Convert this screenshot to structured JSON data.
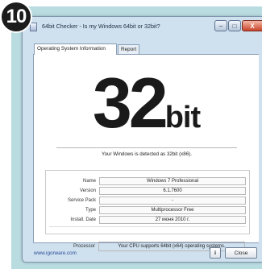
{
  "step_badge": "10",
  "window": {
    "title": "64bit Checker - Is my Windows 64bit or 32bit?",
    "icon": "app-window-icon",
    "controls": {
      "minimize": "–",
      "maximize": "□",
      "close": "X"
    }
  },
  "tabs": [
    {
      "label": "Operating System Information",
      "active": true
    },
    {
      "label": "Report",
      "active": false
    }
  ],
  "result": {
    "number": "32",
    "unit": "bit",
    "detected_text": "Your Windows is detected as 32bit (x86)."
  },
  "info": [
    {
      "label": "Name",
      "value": "Windows 7 Professional"
    },
    {
      "label": "Version",
      "value": "6.1.7600"
    },
    {
      "label": "Service Pack",
      "value": "-"
    },
    {
      "label": "Type",
      "value": "Multiprocessor Free"
    },
    {
      "label": "Install. Date",
      "value": "27 июня 2010 г."
    }
  ],
  "processor": {
    "label": "Processor",
    "value": "Your CPU supports 64bit (x64) operating systems."
  },
  "footer": {
    "link": "www.igorware.com",
    "info_button": "i",
    "close_button": "Close"
  },
  "colors": {
    "background_band": "#b9dce1",
    "window_frame": "#cfe0ee",
    "close_control": "#c9442b",
    "link": "#2b4d99"
  }
}
